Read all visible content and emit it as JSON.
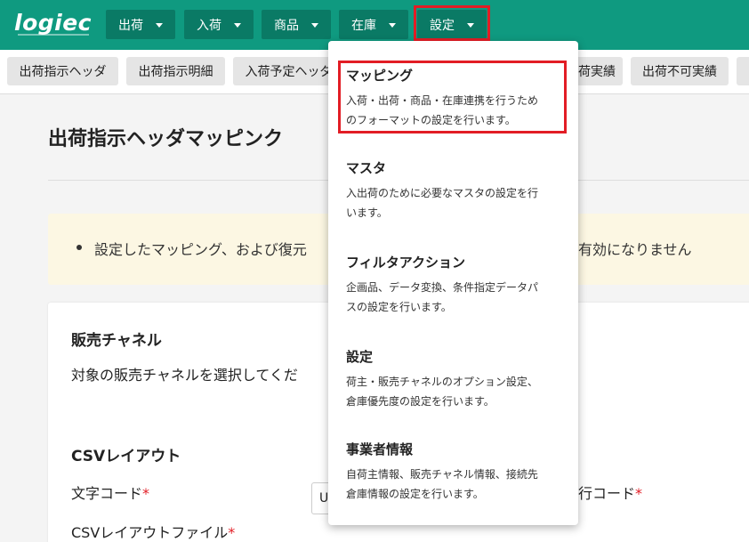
{
  "header": {
    "logo": "logiec",
    "nav": [
      {
        "label": "出荷"
      },
      {
        "label": "入荷"
      },
      {
        "label": "商品"
      },
      {
        "label": "在庫"
      },
      {
        "label": "設定"
      }
    ]
  },
  "subnav": {
    "tabs": [
      {
        "label": "出荷指示ヘッダ"
      },
      {
        "label": "出荷指示明細"
      },
      {
        "label": "入荷予定ヘッダ"
      },
      {
        "label": "荷実績"
      },
      {
        "label": "出荷不可実績"
      }
    ]
  },
  "main": {
    "title": "出荷指示ヘッダマッピンク",
    "notice_left": "設定したマッピング、および復元",
    "notice_right": "有効になりません",
    "sales_channel": {
      "heading": "販売チャネル",
      "description": "対象の販売チャネルを選択してくだ"
    },
    "csv": {
      "heading": "CSVレイアウト",
      "charset_label": "文字コード",
      "charset_value": "U",
      "newline_label": "行コード",
      "file_label": "CSVレイアウトファイル",
      "required_mark": "*"
    }
  },
  "dropdown": {
    "items": [
      {
        "title": "マッピング",
        "desc1": "入荷・出荷・商品・在庫連携を行うため",
        "desc2": "のフォーマットの設定を行います。"
      },
      {
        "title": "マスタ",
        "desc1": "入出荷のために必要なマスタの設定を行",
        "desc2": "います。"
      },
      {
        "title": "フィルタアクション",
        "desc1": "企画品、データ変換、条件指定データパ",
        "desc2": "スの設定を行います。"
      },
      {
        "title": "設定",
        "desc1": "荷主・販売チャネルのオプション設定、",
        "desc2": "倉庫優先度の設定を行います。"
      },
      {
        "title": "事業者情報",
        "desc1": "自荷主情報、販売チャネル情報、接続先",
        "desc2": "倉庫情報の設定を行います。"
      }
    ]
  },
  "colors": {
    "brand": "#0f9a80",
    "nav_button": "#0a7a65",
    "highlight": "#e21d25",
    "notice_bg": "#fcf7e3"
  }
}
